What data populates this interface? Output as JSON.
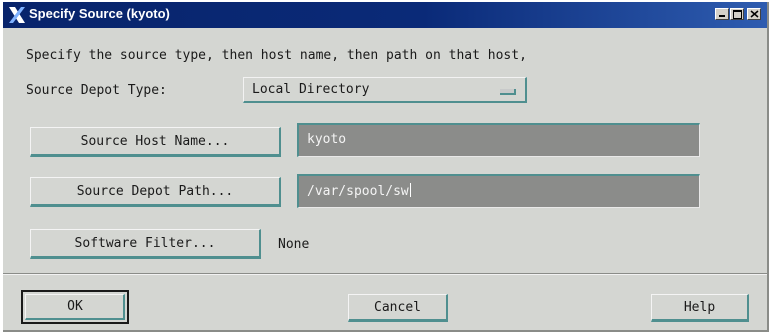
{
  "window": {
    "title": "Specify Source (kyoto)"
  },
  "instruction": "Specify the source type, then host name, then path on that host,",
  "depot_type": {
    "label": "Source Depot Type:",
    "selected": "Local Directory"
  },
  "host": {
    "button_label": "Source Host Name...",
    "value": "kyoto"
  },
  "path": {
    "button_label": "Source Depot Path...",
    "value": "/var/spool/sw"
  },
  "filter": {
    "button_label": "Software Filter...",
    "value": "None"
  },
  "actions": {
    "ok": "OK",
    "cancel": "Cancel",
    "help": "Help"
  },
  "colors": {
    "title_bar": "#08246b",
    "dialog_background": "#d4d6d2",
    "field_background": "#8b8c8a",
    "shadow_accent": "#4f8f8f"
  }
}
